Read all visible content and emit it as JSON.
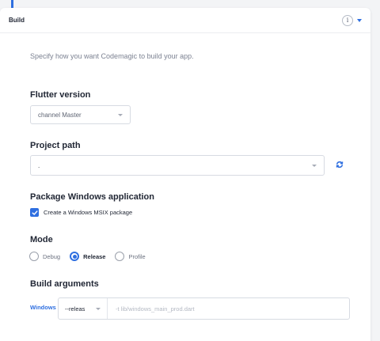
{
  "panel": {
    "title": "Build"
  },
  "description": "Specify how you want Codemagic to build your app.",
  "flutter_version": {
    "title": "Flutter version",
    "selected": "channel Master"
  },
  "project_path": {
    "title": "Project path",
    "value": "."
  },
  "package_windows": {
    "title": "Package Windows application",
    "checkbox_label": "Create a Windows MSIX package",
    "checked": true
  },
  "mode": {
    "title": "Mode",
    "options": [
      {
        "label": "Debug",
        "selected": false
      },
      {
        "label": "Release",
        "selected": true
      },
      {
        "label": "Profile",
        "selected": false
      }
    ]
  },
  "build_arguments": {
    "title": "Build arguments",
    "platform_label": "Windows",
    "mode_value": "--releas",
    "args_placeholder": "-t lib/windows_main_prod.dart"
  },
  "colors": {
    "accent": "#2f6fe0",
    "text": "#1f2533",
    "muted": "#7c8292"
  },
  "icons": [
    "info-icon",
    "caret-down-icon",
    "chevron-down-icon",
    "refresh-icon",
    "check-icon"
  ]
}
